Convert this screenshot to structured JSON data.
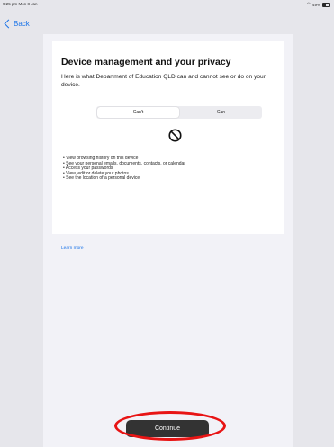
{
  "status_bar": {
    "time_date": "9:25 pm  Mon 8 Jan",
    "battery": "49%",
    "wifi_icon": "wifi-icon",
    "battery_icon": "battery-icon"
  },
  "nav": {
    "back_label": "Back",
    "back_icon": "chevron-left-icon",
    "accent_color": "#1a73e8"
  },
  "privacy": {
    "title": "Device management and your privacy",
    "subtitle": "Here is what Department of Education QLD can and cannot see or do on your device.",
    "segments": [
      {
        "label": "Can't",
        "selected": true
      },
      {
        "label": "Can",
        "selected": false
      }
    ],
    "symbol_icon": "no-symbol-icon",
    "cant_items": [
      "View browsing history on this device",
      "See your personal emails, documents, contacts, or calendar",
      "Access your passwords",
      "View, edit or delete your photos",
      "See the location of a personal device"
    ],
    "learn_more_label": "Learn more"
  },
  "footer": {
    "continue_label": "Continue",
    "highlight_color": "#e81414"
  }
}
